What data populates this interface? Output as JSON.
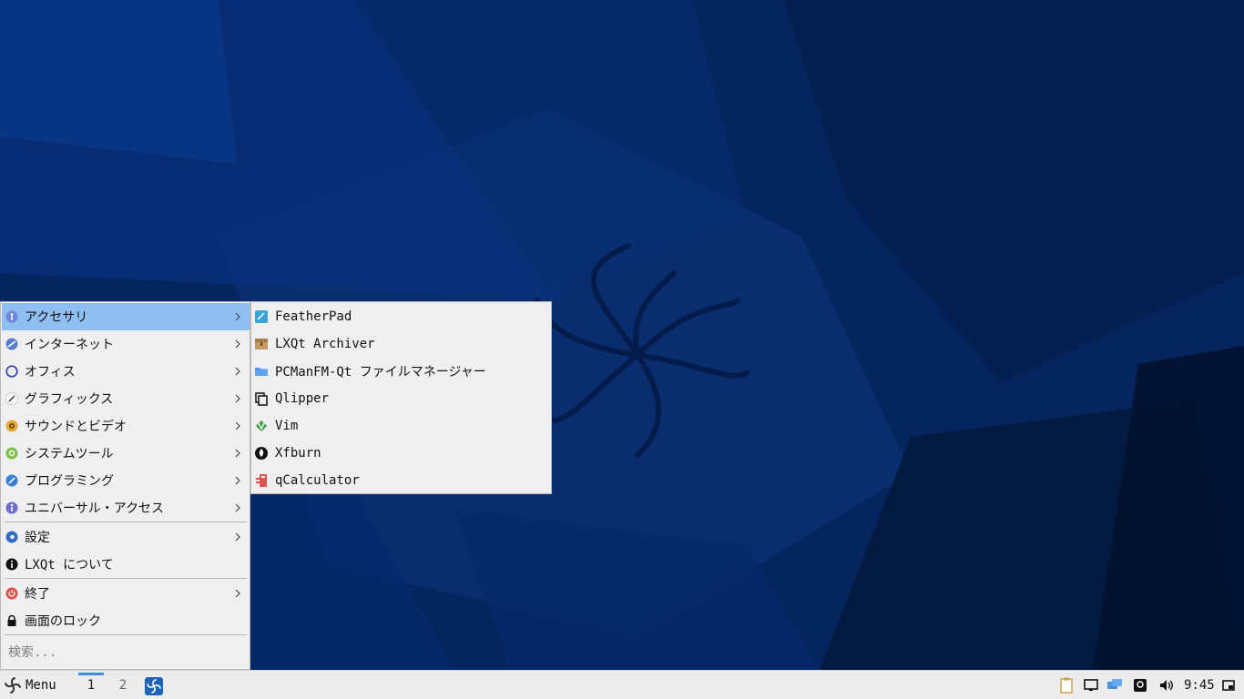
{
  "colors": {
    "desktop_bg": "#05255f",
    "menu_bg": "#efefef",
    "menu_highlight": "#8fbff2",
    "taskbar_bg": "#ececec",
    "desktop_indicator": "#3f8fe0"
  },
  "main_menu": {
    "items": [
      {
        "label": "アクセサリ",
        "icon": "accessories-icon",
        "submenu": true,
        "active": true
      },
      {
        "label": "インターネット",
        "icon": "internet-icon",
        "submenu": true
      },
      {
        "label": "オフィス",
        "icon": "office-icon",
        "submenu": true
      },
      {
        "label": "グラフィックス",
        "icon": "graphics-icon",
        "submenu": true
      },
      {
        "label": "サウンドとビデオ",
        "icon": "sound-video-icon",
        "submenu": true
      },
      {
        "label": "システムツール",
        "icon": "system-tools-icon",
        "submenu": true
      },
      {
        "label": "プログラミング",
        "icon": "programming-icon",
        "submenu": true
      },
      {
        "label": "ユニバーサル・アクセス",
        "icon": "universal-access-icon",
        "submenu": true
      },
      {
        "label": "設定",
        "icon": "settings-icon",
        "submenu": true
      },
      {
        "label": "LXQt について",
        "icon": "info-icon",
        "submenu": false
      },
      {
        "label": "終了",
        "icon": "power-icon",
        "submenu": true
      },
      {
        "label": "画面のロック",
        "icon": "lock-icon",
        "submenu": false
      }
    ],
    "search_placeholder": "検索..."
  },
  "submenu": {
    "items": [
      {
        "label": "FeatherPad",
        "icon": "featherpad-icon"
      },
      {
        "label": "LXQt Archiver",
        "icon": "archiver-icon"
      },
      {
        "label": "PCManFM-Qt ファイルマネージャー",
        "icon": "folder-icon"
      },
      {
        "label": "Qlipper",
        "icon": "clipboard-icon"
      },
      {
        "label": "Vim",
        "icon": "vim-icon"
      },
      {
        "label": "Xfburn",
        "icon": "xfburn-icon"
      },
      {
        "label": "qCalculator",
        "icon": "calculator-icon"
      }
    ]
  },
  "taskbar": {
    "menu_label": "Menu",
    "desktops": [
      "1",
      "2"
    ],
    "clock": "9:45"
  }
}
